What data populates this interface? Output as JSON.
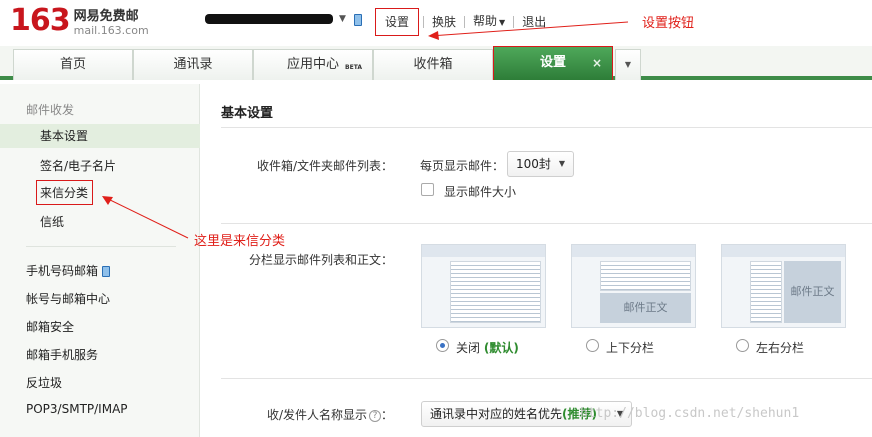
{
  "brand": {
    "number": "163",
    "name_cn": "网易免费邮",
    "domain": "mail.163.com"
  },
  "topbar": {
    "links": {
      "settings": "设置",
      "skin": "换肤",
      "help": "帮助",
      "logout": "退出"
    }
  },
  "tabs": {
    "home": "首页",
    "contacts": "通讯录",
    "apps": "应用中心",
    "apps_badge": "BETA",
    "inbox": "收件箱",
    "settings": "设置",
    "close": "×"
  },
  "sidebar": {
    "group_mail": "邮件收发",
    "items": {
      "basic": "基本设置",
      "signature": "签名/电子名片",
      "filter": "来信分类",
      "stationery": "信纸",
      "mobile_mail": "手机号码邮箱",
      "account_center": "帐号与邮箱中心",
      "security": "邮箱安全",
      "mobile_service": "邮箱手机服务",
      "spam": "反垃圾",
      "pop3": "POP3/SMTP/IMAP"
    }
  },
  "main": {
    "title": "基本设置",
    "list_row": {
      "label": "收件箱/文件夹邮件列表：",
      "per_page_label": "每页显示邮件：",
      "per_page_value": "100封",
      "show_size_label": "显示邮件大小",
      "show_size_checked": false
    },
    "split_row": {
      "label": "分栏显示邮件列表和正文：",
      "preview_text": "邮件正文",
      "options": {
        "off": "关闭",
        "off_default": "(默认)",
        "top_bottom": "上下分栏",
        "left_right": "左右分栏"
      },
      "selected": "off"
    },
    "name_row": {
      "label": "收/发件人名称显示",
      "colon": "：",
      "select_value": "通讯录中对应的姓名优先",
      "select_recommend": "(推荐)"
    }
  },
  "annotations": {
    "settings_button": "设置按钮",
    "filter_here": "这里是来信分类",
    "color": "#e0201a"
  },
  "watermark": "http://blog.csdn.net/shehun1"
}
